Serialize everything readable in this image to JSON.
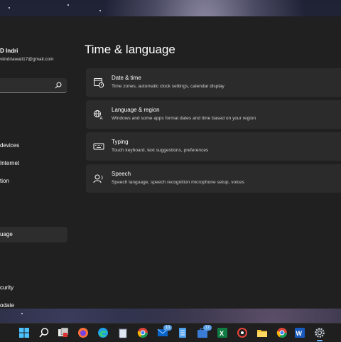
{
  "sidebar": {
    "profile_name": "D Indri",
    "profile_email": "viindriawati17@gmail.com",
    "search_placeholder": "",
    "items": [
      {
        "label": " devices"
      },
      {
        "label": "Internet"
      },
      {
        "label": "tion"
      },
      {
        "label": "uage"
      },
      {
        "label": "curity"
      },
      {
        "label": "odate"
      }
    ]
  },
  "main": {
    "title": "Time & language",
    "cards": [
      {
        "title": "Date & time",
        "desc": "Time zones, automatic clock settings, calendar display",
        "icon": "calendar-clock-icon"
      },
      {
        "title": "Language & region",
        "desc": "Windows and some apps format dates and time based on your region",
        "icon": "language-region-icon"
      },
      {
        "title": "Typing",
        "desc": "Touch keyboard, text suggestions, preferences",
        "icon": "keyboard-icon"
      },
      {
        "title": "Speech",
        "desc": "Speech language, speech recognition microphone setup, voices",
        "icon": "speech-icon"
      }
    ]
  },
  "taskbar": {
    "badges": {
      "mail": "10",
      "store": "17"
    },
    "icons": [
      "start-icon",
      "search-icon",
      "task-view-icon",
      "firefox-icon",
      "edge-icon",
      "recycle-bin-icon",
      "chrome-icon",
      "mail-icon",
      "notepad-icon",
      "store-icon",
      "excel-icon",
      "photo-icon",
      "file-explorer-icon",
      "chrome-icon",
      "word-icon",
      "settings-icon"
    ]
  },
  "colors": {
    "window_bg": "#202020",
    "card_bg": "#2b2b2b",
    "accent": "#6cb6ff",
    "taskbar_bg": "#1f1f1f"
  }
}
